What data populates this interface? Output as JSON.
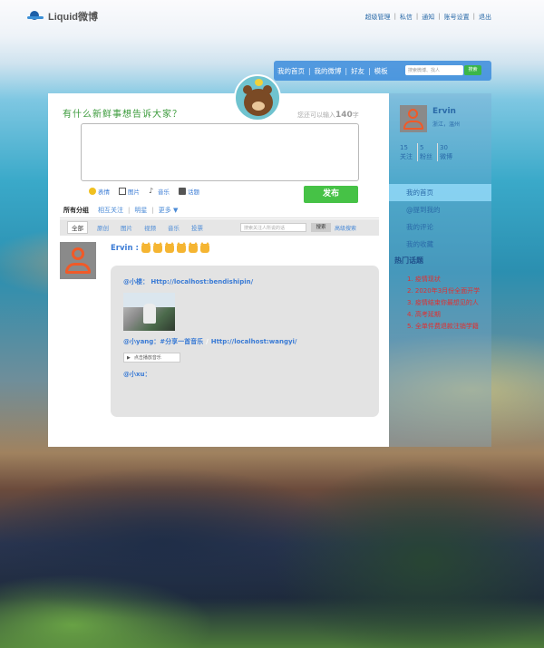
{
  "app": {
    "logo_text": "Liquid微博"
  },
  "top_links": [
    "超级管理",
    "私信",
    "通知",
    "账号设置",
    "退出"
  ],
  "nav": {
    "items": [
      "我的首页",
      "我的微博",
      "好友",
      "模板"
    ],
    "search_placeholder": "搜索微博、找人",
    "search_button": "搜索"
  },
  "composer": {
    "prompt": "有什么新鲜事想告诉大家？",
    "counter_prefix": "您还可以输入",
    "counter_number": "140",
    "counter_suffix": "字",
    "tools": [
      "表情",
      "图片",
      "音乐",
      "话题"
    ],
    "publish_label": "发布"
  },
  "tabs": {
    "active": "所有分组",
    "items": [
      "相互关注",
      "明星",
      "更多 ▼"
    ]
  },
  "filters": {
    "all": "全部",
    "items": [
      "原创",
      "图片",
      "视频",
      "音乐",
      "投票"
    ],
    "search_placeholder": "搜索关注人所说的话",
    "search_button": "搜索",
    "advanced": "高级搜索"
  },
  "post": {
    "author": "Ervin :",
    "emoji_count": 6,
    "quote_line1": "@小楼： Http://localhost:bendishipin/",
    "quote_line2_a": "@小yang：#分享一首音乐",
    "quote_line2_sep": "/",
    "quote_line2_b": "Http://localhost:wangyi/",
    "music_button": "点击播放音乐",
    "quote_line3": "@小xu："
  },
  "sidebar": {
    "name": "Ervin",
    "location": "浙江，温州",
    "stats": [
      {
        "count": "15",
        "label": "关注"
      },
      {
        "count": "5",
        "label": "粉丝"
      },
      {
        "count": "30",
        "label": "微博"
      }
    ],
    "menu": [
      "我的首页",
      "@提到我的",
      "我的评论",
      "我的收藏"
    ],
    "hot_title": "热门话题",
    "hot_topics": [
      "1. 疫情现状",
      "2. 2020年3月份全面开学",
      "3. 疫情结束你最想见的人",
      "4. 高考延期",
      "5. 全单件费退款注销学籍"
    ]
  },
  "colors": {
    "accent": "#3a7bd5",
    "publish": "#46c246",
    "navbar": "#3c8cdc",
    "hot_topic": "#e03030"
  }
}
